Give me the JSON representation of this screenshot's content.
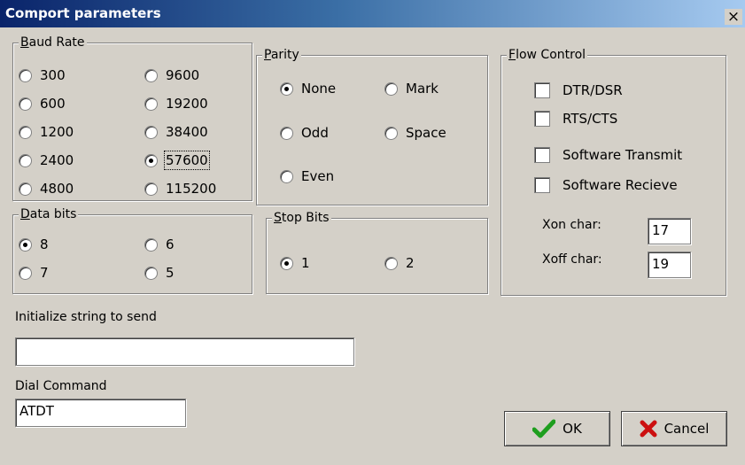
{
  "window": {
    "title": "Comport parameters",
    "close_glyph": "×"
  },
  "baud_rate": {
    "legend": "Baud Rate",
    "options": [
      "300",
      "600",
      "1200",
      "2400",
      "4800",
      "9600",
      "19200",
      "38400",
      "57600",
      "115200"
    ],
    "selected": "57600"
  },
  "parity": {
    "legend": "Parity",
    "options": [
      "None",
      "Mark",
      "Odd",
      "Space",
      "Even"
    ],
    "selected": "None"
  },
  "flow_control": {
    "legend": "Flow Control",
    "options": [
      "DTR/DSR",
      "RTS/CTS",
      "Software Transmit",
      "Software Recieve"
    ],
    "checked": [],
    "xon_label": "Xon char:",
    "xon_value": "17",
    "xoff_label": "Xoff char:",
    "xoff_value": "19"
  },
  "data_bits": {
    "legend": "Data bits",
    "options": [
      "8",
      "6",
      "7",
      "5"
    ],
    "selected": "8"
  },
  "stop_bits": {
    "legend": "Stop Bits",
    "options": [
      "1",
      "2"
    ],
    "selected": "1"
  },
  "init_string": {
    "label": "Initialize string to send",
    "value": ""
  },
  "dial_command": {
    "label": "Dial Command",
    "value": "ATDT"
  },
  "buttons": {
    "ok": "OK",
    "cancel": "Cancel"
  },
  "colors": {
    "ok_check": "#1e9e1e",
    "cancel_x": "#cc1010",
    "titlebar_start": "#0a246a",
    "titlebar_end": "#a6caf0"
  }
}
